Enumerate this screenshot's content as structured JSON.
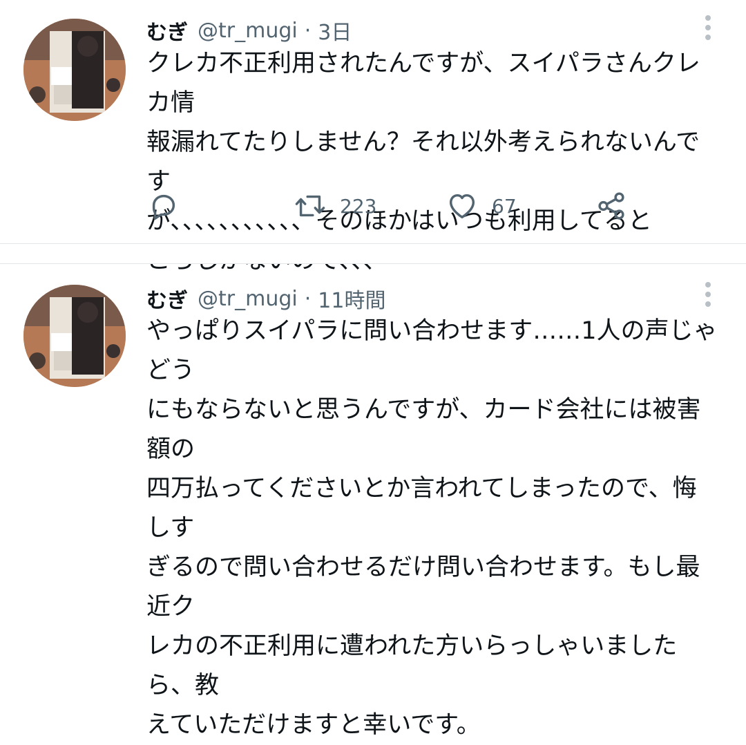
{
  "colors": {
    "text_primary": "#0f1419",
    "text_secondary": "#536471",
    "divider": "#e3e6e8",
    "icon": "#536471",
    "more_dots": "#b8c0c6"
  },
  "tweets": [
    {
      "author_name": "むぎ",
      "handle": "@tr_mugi",
      "separator": "·",
      "time": "3日",
      "text": "クレカ不正利用されたんですが、スイパラさんクレカ情\n報漏れてたりしません？それ以外考えられないんです\nが、、、、、、、、、、、そのほかはいつも利用してると\nころしかないので、、、",
      "retweet_count": "223",
      "like_count": "67",
      "icons": [
        "reply-icon",
        "retweet-icon",
        "heart-icon",
        "share-icon",
        "more-icon"
      ]
    },
    {
      "author_name": "むぎ",
      "handle": "@tr_mugi",
      "separator": "·",
      "time": "11時間",
      "text": "やっぱりスイパラに問い合わせます……1人の声じゃどう\nにもならないと思うんですが、カード会社には被害額の\n四万払ってくださいとか言われてしまったので、悔しす\nぎるので問い合わせるだけ問い合わせます。もし最近ク\nレカの不正利用に遭われた方いらっしゃいましたら、教\nえていただけますと幸いです。",
      "icons": [
        "more-icon"
      ]
    }
  ]
}
